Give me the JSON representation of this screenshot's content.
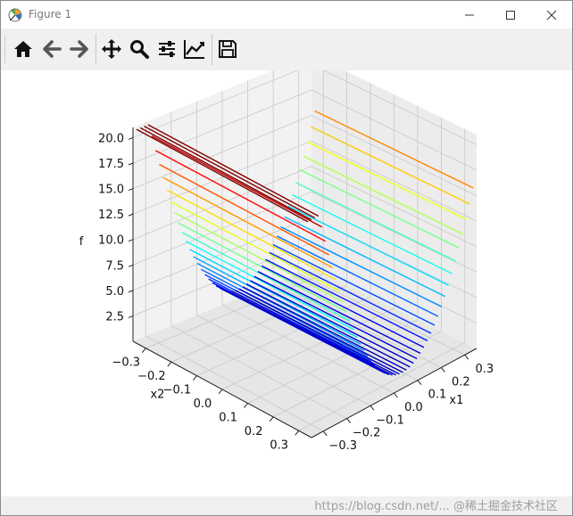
{
  "window": {
    "title": "Figure 1"
  },
  "toolbar": {
    "buttons": [
      {
        "name": "home-icon",
        "label": "Home"
      },
      {
        "name": "back-arrow-icon",
        "label": "Back"
      },
      {
        "name": "forward-arrow-icon",
        "label": "Forward"
      },
      {
        "name": "pan-move-icon",
        "label": "Pan"
      },
      {
        "name": "zoom-magnifier-icon",
        "label": "Zoom"
      },
      {
        "name": "subplots-config-icon",
        "label": "Subplots"
      },
      {
        "name": "customize-axes-icon",
        "label": "Customize"
      },
      {
        "name": "save-floppy-icon",
        "label": "Save"
      }
    ]
  },
  "colors": {
    "toolbar_bg": "#f0f0f0",
    "pane_gray": "#f2f2f2",
    "grid": "#c8c8c8",
    "low": "#00008b",
    "high": "#b50000"
  },
  "chart_data": {
    "type": "surface-3d",
    "colormap": "jet",
    "zlabel": "f",
    "xlabel": "x1",
    "ylabel": "x2",
    "x_ticks": [
      "−0.3",
      "−0.2",
      "−0.1",
      "0.0",
      "0.1",
      "0.2",
      "0.3"
    ],
    "y_ticks": [
      "−0.3",
      "−0.2",
      "−0.1",
      "0.0",
      "0.1",
      "0.2",
      "0.3"
    ],
    "z_ticks": [
      "2.5",
      "5.0",
      "7.5",
      "10.0",
      "12.5",
      "15.0",
      "17.5",
      "20.0"
    ],
    "xlim": [
      -0.35,
      0.35
    ],
    "ylim": [
      -0.35,
      0.35
    ],
    "zlim": [
      0,
      21
    ],
    "grid": true
  },
  "statusbar": {
    "watermark": "https://blog.csdn.net/... @稀土掘金技术社区"
  }
}
